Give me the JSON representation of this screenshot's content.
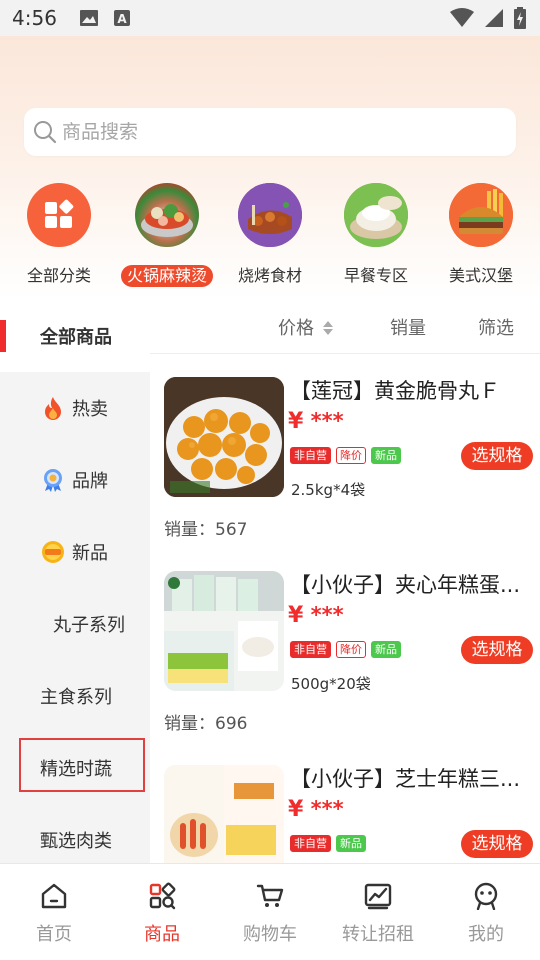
{
  "status_bar": {
    "time": "4:56"
  },
  "search": {
    "placeholder": "商品搜索"
  },
  "categories": [
    {
      "label": "全部分类",
      "icon": "grid-icon",
      "active": false
    },
    {
      "label": "火锅麻辣烫",
      "icon": "hotpot-image",
      "active": true
    },
    {
      "label": "烧烤食材",
      "icon": "bbq-image",
      "active": false
    },
    {
      "label": "早餐专区",
      "icon": "breakfast-image",
      "active": false
    },
    {
      "label": "美式汉堡",
      "icon": "burger-image",
      "active": false
    }
  ],
  "sort_bar": {
    "price": "价格",
    "sales": "销量",
    "filter": "筛选"
  },
  "sidebar": {
    "items": [
      {
        "label": "全部商品",
        "icon": ""
      },
      {
        "label": "热卖",
        "icon": "flame-icon"
      },
      {
        "label": "品牌",
        "icon": "medal-icon"
      },
      {
        "label": "新品",
        "icon": "new-badge-icon"
      },
      {
        "label": "丸子系列",
        "icon": ""
      },
      {
        "label": "主食系列",
        "icon": ""
      },
      {
        "label": "精选时蔬",
        "icon": ""
      },
      {
        "label": "甄选肉类",
        "icon": ""
      }
    ]
  },
  "products": [
    {
      "title": "【莲冠】黄金脆骨丸Ｆ",
      "currency": "¥",
      "price": "***",
      "tags": [
        "非自营",
        "降价",
        "新品"
      ],
      "spec": "2.5kg*4袋",
      "button": "选规格",
      "sales_label": "销量：",
      "sales": "567"
    },
    {
      "title": "【小伙子】夹心年糕蛋...",
      "currency": "¥",
      "price": "***",
      "tags": [
        "非自营",
        "降价",
        "新品"
      ],
      "spec": "500g*20袋",
      "button": "选规格",
      "sales_label": "销量：",
      "sales": "696"
    },
    {
      "title": "【小伙子】芝士年糕三...",
      "currency": "¥",
      "price": "***",
      "tags": [
        "非自营",
        "新品"
      ],
      "spec": "",
      "button": "选规格",
      "sales_label": "",
      "sales": ""
    }
  ],
  "bottom_nav": [
    {
      "label": "首页",
      "icon": "home-icon",
      "active": false
    },
    {
      "label": "商品",
      "icon": "goods-icon",
      "active": true
    },
    {
      "label": "购物车",
      "icon": "cart-icon",
      "active": false
    },
    {
      "label": "转让招租",
      "icon": "chart-icon",
      "active": false
    },
    {
      "label": "我的",
      "icon": "profile-icon",
      "active": false
    }
  ],
  "colors": {
    "accent": "#ee3d24",
    "price": "#f02c2c",
    "new_tag": "#4cc94c",
    "highlight": "#e04040"
  }
}
